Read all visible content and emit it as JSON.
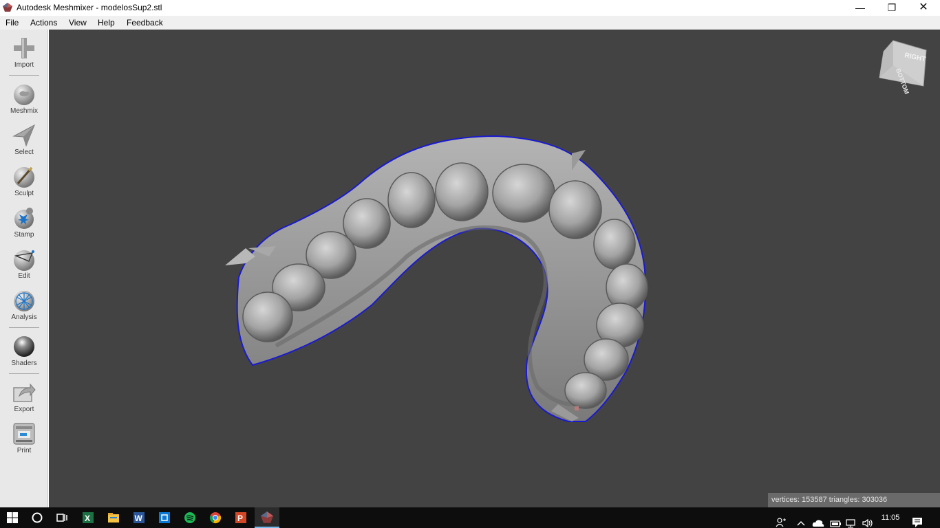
{
  "window": {
    "title": "Autodesk Meshmixer - modelosSup2.stl",
    "minimize_glyph": "—",
    "restore_glyph": "❐",
    "close_glyph": "✕"
  },
  "menu": {
    "items": [
      "File",
      "Actions",
      "View",
      "Help",
      "Feedback"
    ]
  },
  "toolbar": {
    "tools": [
      {
        "label": "Import",
        "icon": "plus-icon"
      },
      {
        "label": "Meshmix",
        "icon": "bunny-sphere-icon"
      },
      {
        "label": "Select",
        "icon": "select-arrow-icon"
      },
      {
        "label": "Sculpt",
        "icon": "sculpt-brush-icon"
      },
      {
        "label": "Stamp",
        "icon": "stamp-icon"
      },
      {
        "label": "Edit",
        "icon": "edit-sphere-icon"
      },
      {
        "label": "Analysis",
        "icon": "analysis-sphere-icon"
      },
      {
        "label": "Shaders",
        "icon": "shader-ball-icon"
      },
      {
        "label": "Export",
        "icon": "export-icon"
      },
      {
        "label": "Print",
        "icon": "printer-icon"
      }
    ]
  },
  "viewport": {
    "background": "#434343",
    "mesh_color": "#a9a9a9",
    "outline_color": "#1010c8",
    "navcube": {
      "face_right": "RIGHT",
      "face_bottom": "BOTTOM"
    },
    "stats": "vertices: 153587 triangles: 303036"
  },
  "taskbar": {
    "apps": [
      "windows-start-icon",
      "cortana-icon",
      "task-view-icon",
      "excel-icon",
      "file-explorer-icon",
      "word-icon",
      "store-icon",
      "spotify-icon",
      "chrome-icon",
      "powerpoint-icon",
      "meshmixer-icon"
    ],
    "time": "11:05"
  }
}
